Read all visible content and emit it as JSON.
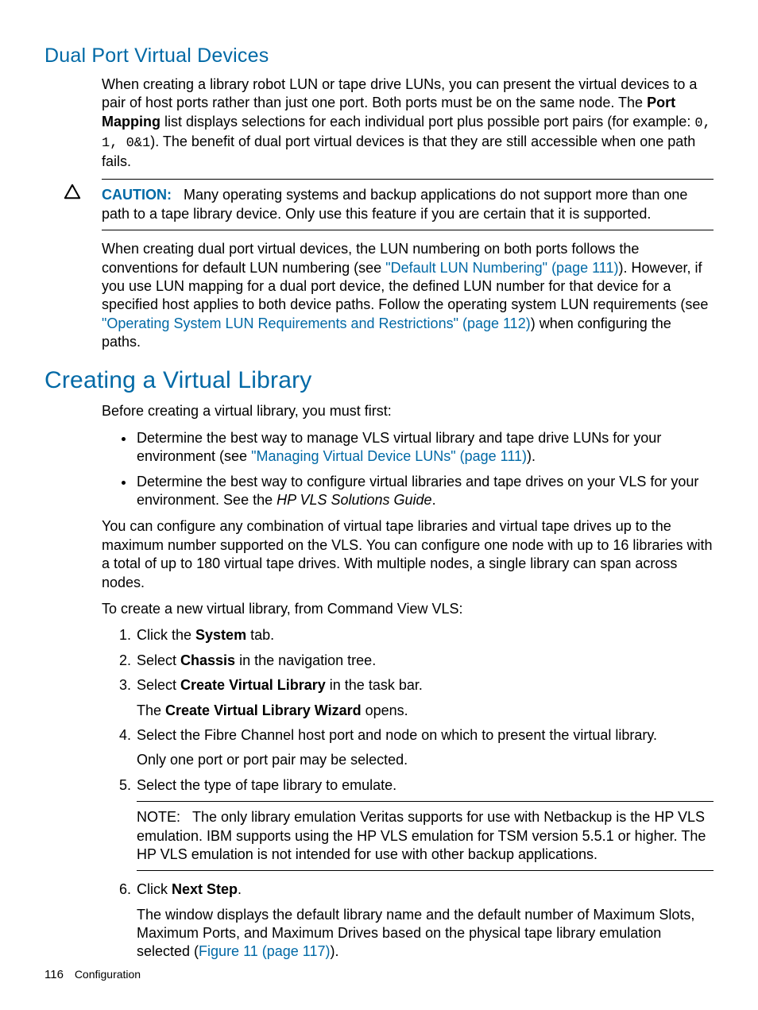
{
  "section1": {
    "title": "Dual Port Virtual Devices",
    "para1_a": "When creating a library robot LUN or tape drive LUNs, you can present the virtual devices to a pair of host ports rather than just one port. Both ports must be on the same node. The ",
    "para1_bold": "Port Mapping",
    "para1_b": " list displays selections for each individual port plus possible port pairs (for example: ",
    "para1_mono": "0, 1, 0&1",
    "para1_c": "). The benefit of dual port virtual devices is that they are still accessible when one path fails.",
    "caution_label": "CAUTION:",
    "caution_text": "Many operating systems and backup applications do not support more than one path to a tape library device. Only use this feature if you are certain that it is supported.",
    "para2_a": "When creating dual port virtual devices, the LUN numbering on both ports follows the conventions for default LUN numbering (see ",
    "para2_link1": "\"Default LUN Numbering\" (page 111)",
    "para2_b": "). However, if you use LUN mapping for a dual port device, the defined LUN number for that device for a specified host applies to both device paths. Follow the operating system LUN requirements (see ",
    "para2_link2": "\"Operating System LUN Requirements and Restrictions\" (page 112)",
    "para2_c": ") when configuring the paths."
  },
  "section2": {
    "title": "Creating a Virtual Library",
    "intro": "Before creating a virtual library, you must first:",
    "bullets": {
      "b1_a": "Determine the best way to manage VLS virtual library and tape drive LUNs for your environment (see ",
      "b1_link": "\"Managing Virtual Device LUNs\" (page 111)",
      "b1_b": ").",
      "b2_a": "Determine the best way to configure virtual libraries and tape drives on your VLS for your environment. See the ",
      "b2_italic": "HP VLS Solutions Guide",
      "b2_b": "."
    },
    "para3": "You can configure any combination of virtual tape libraries and virtual tape drives up to the maximum number supported on the VLS. You can configure one node with up to 16 libraries with a total of up to 180 virtual tape drives. With multiple nodes, a single library can span across nodes.",
    "para4": "To create a new virtual library, from Command View VLS:",
    "steps": {
      "s1_a": "Click the ",
      "s1_bold": "System",
      "s1_b": " tab.",
      "s2_a": "Select ",
      "s2_bold": "Chassis",
      "s2_b": " in the navigation tree.",
      "s3_a": "Select ",
      "s3_bold": "Create Virtual Library",
      "s3_b": " in the task bar.",
      "s3_sub_a": "The ",
      "s3_sub_bold": "Create Virtual Library Wizard",
      "s3_sub_b": " opens.",
      "s4": "Select the Fibre Channel host port and node on which to present the virtual library.",
      "s4_sub": "Only one port or port pair may be selected.",
      "s5": "Select the type of tape library to emulate.",
      "s5_note_label": "NOTE:",
      "s5_note_text": "The only library emulation Veritas supports for use with Netbackup is the HP VLS emulation. IBM supports using the HP VLS emulation for TSM version 5.5.1 or higher. The HP VLS emulation is not intended for use with other backup applications.",
      "s6_a": "Click ",
      "s6_bold": "Next Step",
      "s6_b": ".",
      "s6_sub_a": "The window displays the default library name and the default number of Maximum Slots, Maximum Ports, and Maximum Drives based on the physical tape library emulation selected (",
      "s6_sub_link": "Figure 11 (page 117)",
      "s6_sub_b": ")."
    }
  },
  "footer": {
    "page": "116",
    "section": "Configuration"
  }
}
